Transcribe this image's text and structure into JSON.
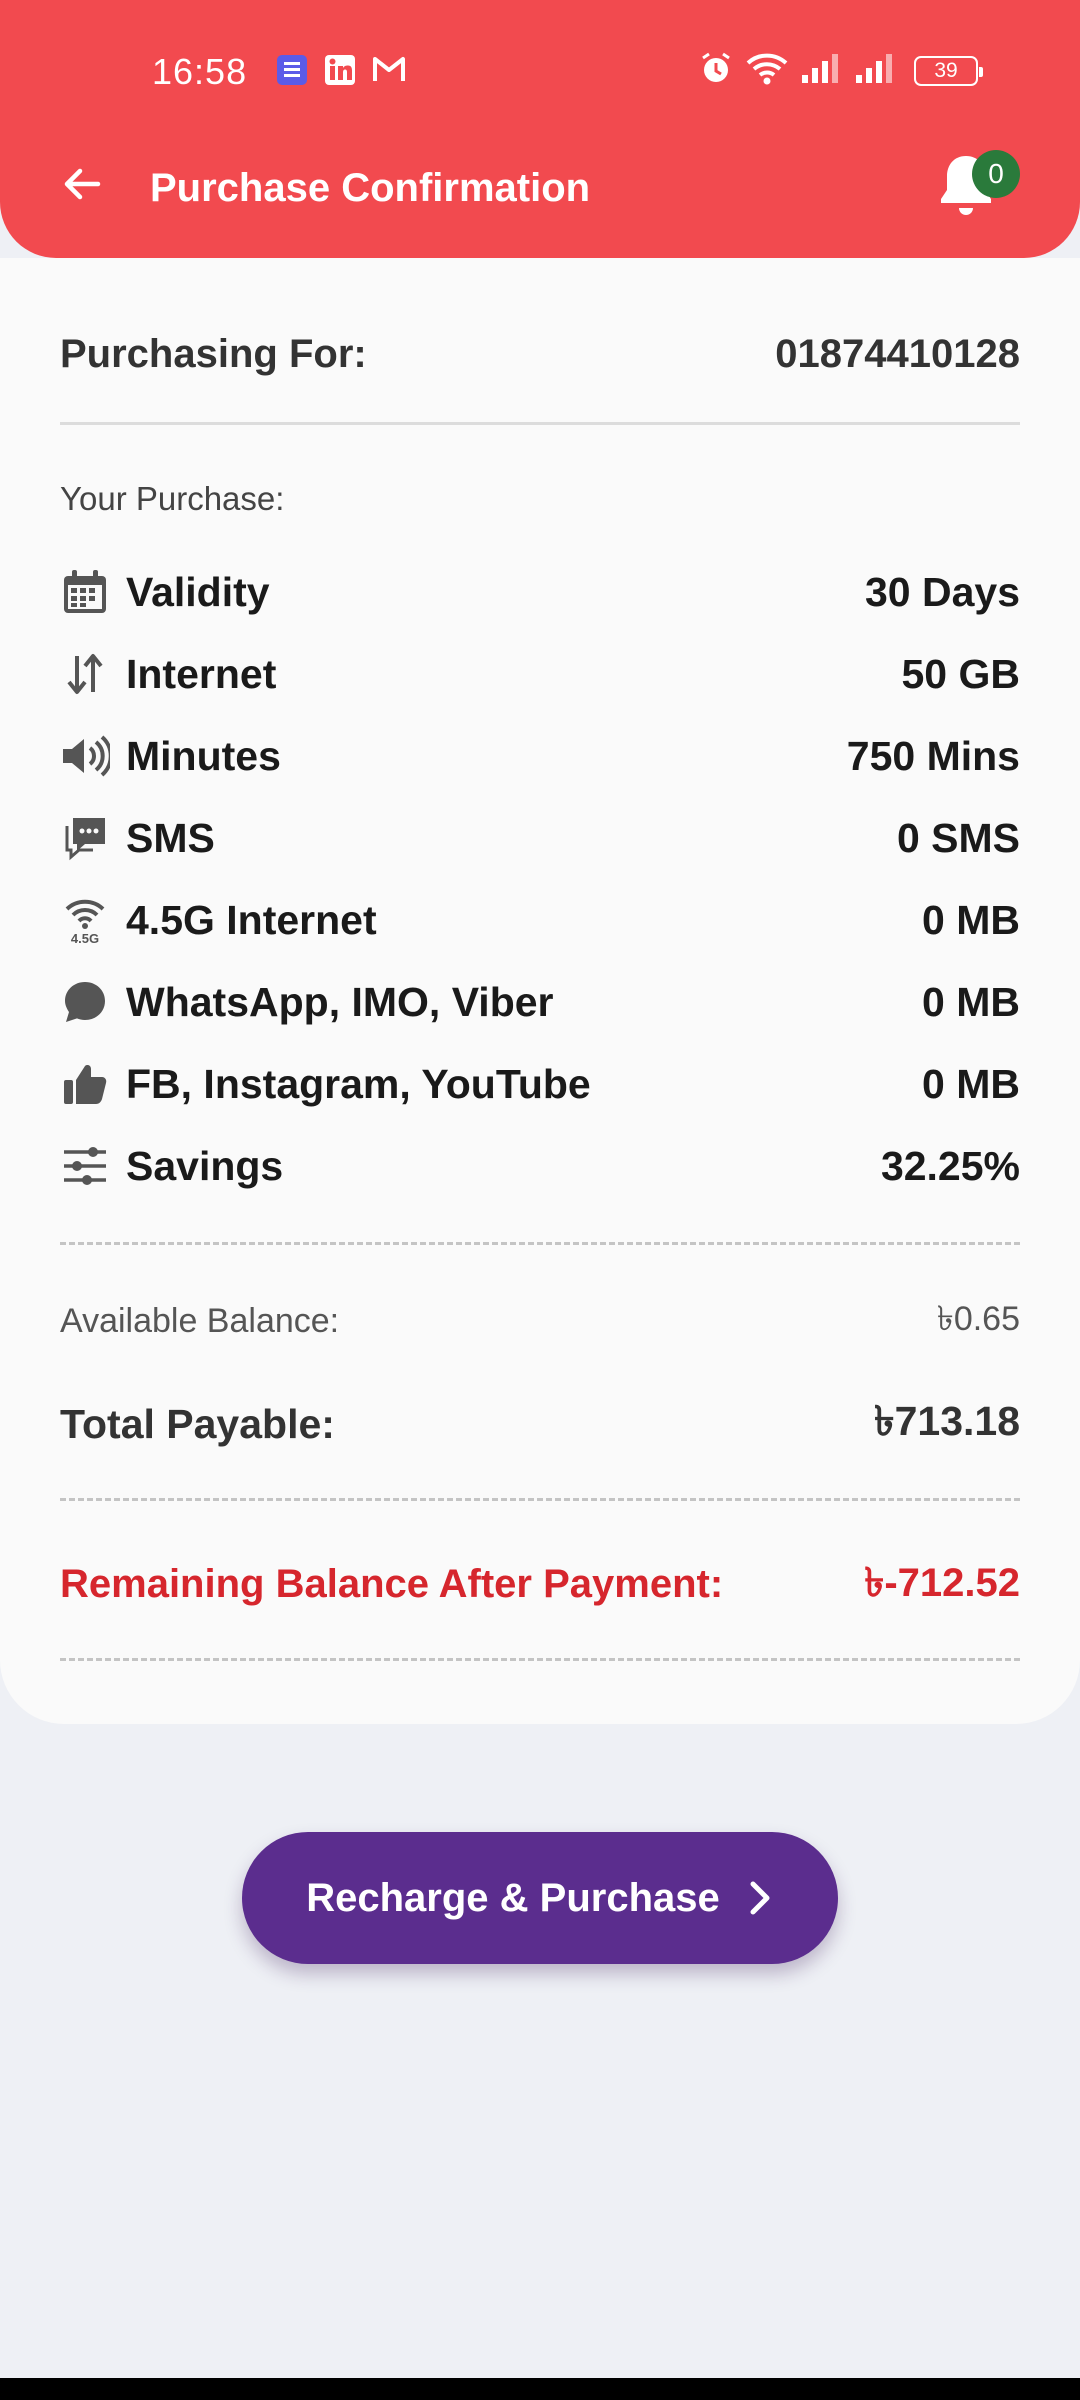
{
  "status_bar": {
    "time": "16:58",
    "battery": "39",
    "app_icons": [
      "tasks-icon",
      "linkedin-icon",
      "gmail-icon"
    ],
    "system_icons": [
      "alarm-icon",
      "wifi-icon",
      "signal-icon",
      "signal-icon"
    ]
  },
  "app_bar": {
    "title": "Purchase Confirmation",
    "notification_count": "0"
  },
  "purchase": {
    "purchasing_for_label": "Purchasing For:",
    "phone_number": "01874410128",
    "your_purchase_label": "Your Purchase:",
    "items": [
      {
        "icon": "calendar-icon",
        "label": "Validity",
        "value": "30 Days"
      },
      {
        "icon": "data-transfer-icon",
        "label": "Internet",
        "value": "50 GB"
      },
      {
        "icon": "speaker-icon",
        "label": "Minutes",
        "value": "750 Mins"
      },
      {
        "icon": "chat-icon",
        "label": "SMS",
        "value": "0 SMS"
      },
      {
        "icon": "wifi-4-5g-icon",
        "label": "4.5G Internet",
        "value": "0 MB"
      },
      {
        "icon": "message-bubble-icon",
        "label": "WhatsApp, IMO, Viber",
        "value": "0 MB"
      },
      {
        "icon": "thumbs-up-icon",
        "label": "FB, Instagram, YouTube",
        "value": "0 MB"
      },
      {
        "icon": "sliders-icon",
        "label": "Savings",
        "value": "32.25%"
      }
    ],
    "available_balance_label": "Available Balance:",
    "available_balance": "৳0.65",
    "total_payable_label": "Total Payable:",
    "total_payable": "৳713.18",
    "remaining_label": "Remaining Balance After Payment:",
    "remaining_balance": "৳-712.52"
  },
  "cta": {
    "label": "Recharge & Purchase"
  },
  "colors": {
    "header": "#f24a4f",
    "badge": "#2a7a3b",
    "cta": "#5b2d8e",
    "negative": "#d6262d"
  }
}
